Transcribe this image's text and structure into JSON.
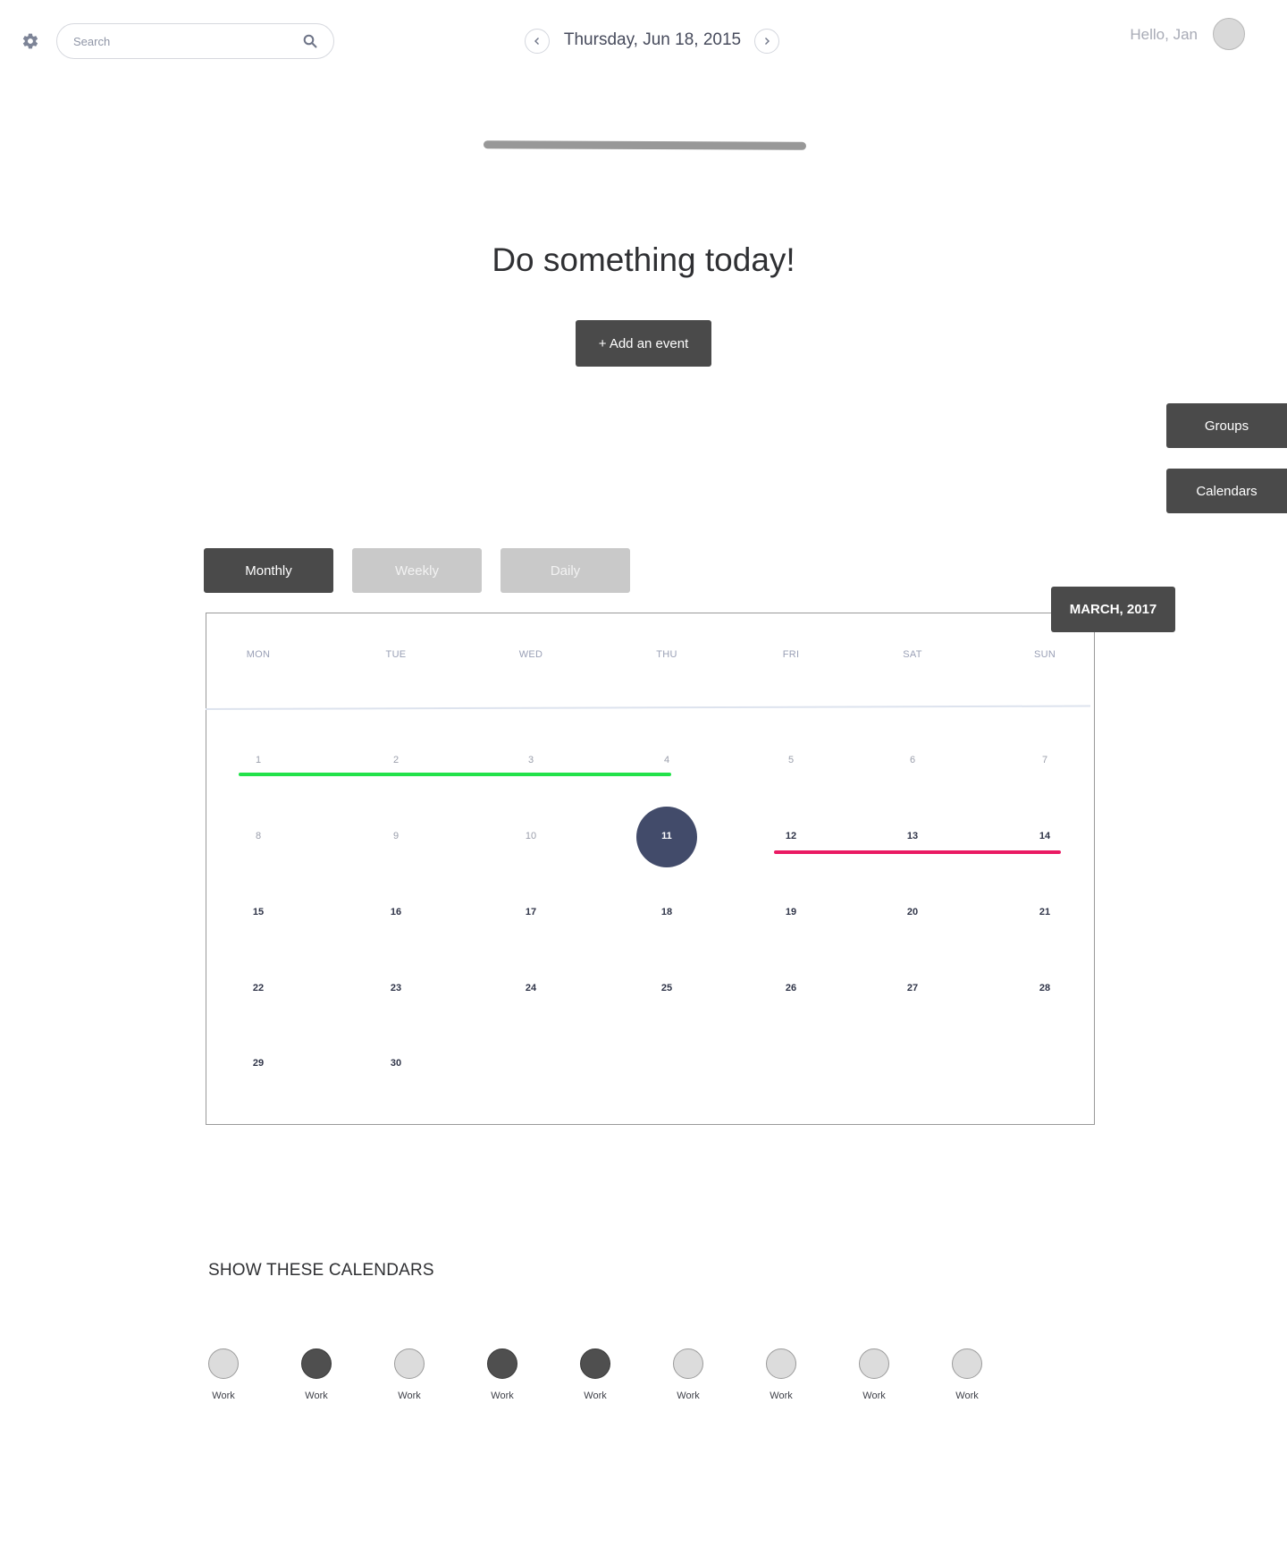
{
  "header": {
    "settings_icon": "gear-icon",
    "search": {
      "placeholder": "Search",
      "value": "",
      "icon": "search-icon"
    },
    "date_title": "Thursday, Jun 18, 2015",
    "prev_icon": "chevron-left-icon",
    "next_icon": "chevron-right-icon",
    "greeting": "Hello, Jan"
  },
  "hero": {
    "headline": "Do something today!",
    "add_event_label": "+ Add an event"
  },
  "side_menu": {
    "groups_label": "Groups",
    "calendars_label": "Calendars"
  },
  "views": {
    "monthly": "Monthly",
    "weekly": "Weekly",
    "daily": "Daily",
    "active": "Monthly"
  },
  "calendar": {
    "month_label": "MARCH, 2017",
    "weekdays": [
      "MON",
      "TUE",
      "WED",
      "THU",
      "FRI",
      "SAT",
      "SUN"
    ],
    "weeks": [
      [
        "1",
        "2",
        "3",
        "4",
        "5",
        "6",
        "7"
      ],
      [
        "8",
        "9",
        "10",
        "11",
        "12",
        "13",
        "14"
      ],
      [
        "15",
        "16",
        "17",
        "18",
        "19",
        "20",
        "21"
      ],
      [
        "22",
        "23",
        "24",
        "25",
        "26",
        "27",
        "28"
      ],
      [
        "29",
        "30",
        "",
        "",
        "",
        "",
        ""
      ]
    ],
    "selected_day": "11",
    "events": [
      {
        "from": "1",
        "to": "4",
        "color": "#22e24a"
      },
      {
        "from": "12",
        "to": "14",
        "color": "#ea1a63"
      }
    ]
  },
  "calendars_section": {
    "title": "SHOW THESE CALENDARS",
    "items": [
      {
        "label": "Work",
        "enabled": false
      },
      {
        "label": "Work",
        "enabled": true
      },
      {
        "label": "Work",
        "enabled": false
      },
      {
        "label": "Work",
        "enabled": true
      },
      {
        "label": "Work",
        "enabled": true
      },
      {
        "label": "Work",
        "enabled": false
      },
      {
        "label": "Work",
        "enabled": false
      },
      {
        "label": "Work",
        "enabled": false
      },
      {
        "label": "Work",
        "enabled": false
      }
    ]
  },
  "colors": {
    "primary_dark": "#4a4a4a",
    "inactive": "#c9c9c9",
    "today": "#424b6a",
    "event_green": "#22e24a",
    "event_pink": "#ea1a63"
  }
}
